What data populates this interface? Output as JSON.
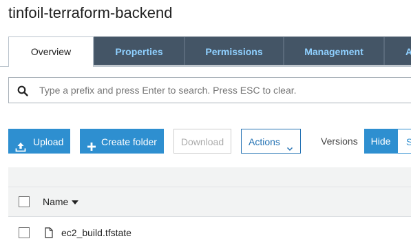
{
  "bucket": {
    "title": "tinfoil-terraform-backend"
  },
  "tabs": [
    {
      "label": "Overview",
      "active": true
    },
    {
      "label": "Properties",
      "active": false
    },
    {
      "label": "Permissions",
      "active": false
    },
    {
      "label": "Management",
      "active": false
    },
    {
      "label": "A",
      "active": false
    }
  ],
  "search": {
    "placeholder": "Type a prefix and press Enter to search. Press ESC to clear.",
    "value": ""
  },
  "toolbar": {
    "upload_label": "Upload",
    "create_folder_label": "Create folder",
    "download_label": "Download",
    "actions_label": "Actions",
    "versions_label": "Versions",
    "hide_label": "Hide",
    "show_label": "S"
  },
  "table": {
    "columns": [
      {
        "label": "Name",
        "sort": "descending"
      }
    ],
    "rows": [
      {
        "name": "ec2_build.tfstate",
        "type": "file",
        "checked": false
      }
    ]
  },
  "colors": {
    "tab_bg": "#445566",
    "tab_text": "#8fd0ff",
    "primary": "#2e8fd0",
    "link": "#2271b3",
    "table_header_bg": "#f2f3f3"
  }
}
